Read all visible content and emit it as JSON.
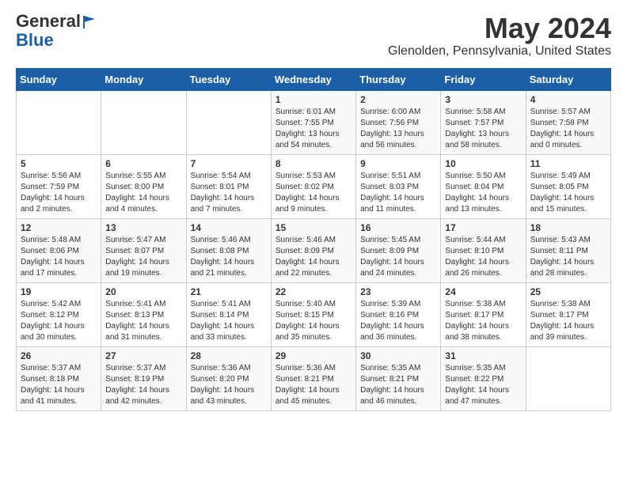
{
  "header": {
    "logo_general": "General",
    "logo_blue": "Blue",
    "month": "May 2024",
    "location": "Glenolden, Pennsylvania, United States"
  },
  "days_of_week": [
    "Sunday",
    "Monday",
    "Tuesday",
    "Wednesday",
    "Thursday",
    "Friday",
    "Saturday"
  ],
  "weeks": [
    [
      {
        "day": "",
        "sunrise": "",
        "sunset": "",
        "daylight": ""
      },
      {
        "day": "",
        "sunrise": "",
        "sunset": "",
        "daylight": ""
      },
      {
        "day": "",
        "sunrise": "",
        "sunset": "",
        "daylight": ""
      },
      {
        "day": "1",
        "sunrise": "Sunrise: 6:01 AM",
        "sunset": "Sunset: 7:55 PM",
        "daylight": "Daylight: 13 hours and 54 minutes."
      },
      {
        "day": "2",
        "sunrise": "Sunrise: 6:00 AM",
        "sunset": "Sunset: 7:56 PM",
        "daylight": "Daylight: 13 hours and 56 minutes."
      },
      {
        "day": "3",
        "sunrise": "Sunrise: 5:58 AM",
        "sunset": "Sunset: 7:57 PM",
        "daylight": "Daylight: 13 hours and 58 minutes."
      },
      {
        "day": "4",
        "sunrise": "Sunrise: 5:57 AM",
        "sunset": "Sunset: 7:58 PM",
        "daylight": "Daylight: 14 hours and 0 minutes."
      }
    ],
    [
      {
        "day": "5",
        "sunrise": "Sunrise: 5:56 AM",
        "sunset": "Sunset: 7:59 PM",
        "daylight": "Daylight: 14 hours and 2 minutes."
      },
      {
        "day": "6",
        "sunrise": "Sunrise: 5:55 AM",
        "sunset": "Sunset: 8:00 PM",
        "daylight": "Daylight: 14 hours and 4 minutes."
      },
      {
        "day": "7",
        "sunrise": "Sunrise: 5:54 AM",
        "sunset": "Sunset: 8:01 PM",
        "daylight": "Daylight: 14 hours and 7 minutes."
      },
      {
        "day": "8",
        "sunrise": "Sunrise: 5:53 AM",
        "sunset": "Sunset: 8:02 PM",
        "daylight": "Daylight: 14 hours and 9 minutes."
      },
      {
        "day": "9",
        "sunrise": "Sunrise: 5:51 AM",
        "sunset": "Sunset: 8:03 PM",
        "daylight": "Daylight: 14 hours and 11 minutes."
      },
      {
        "day": "10",
        "sunrise": "Sunrise: 5:50 AM",
        "sunset": "Sunset: 8:04 PM",
        "daylight": "Daylight: 14 hours and 13 minutes."
      },
      {
        "day": "11",
        "sunrise": "Sunrise: 5:49 AM",
        "sunset": "Sunset: 8:05 PM",
        "daylight": "Daylight: 14 hours and 15 minutes."
      }
    ],
    [
      {
        "day": "12",
        "sunrise": "Sunrise: 5:48 AM",
        "sunset": "Sunset: 8:06 PM",
        "daylight": "Daylight: 14 hours and 17 minutes."
      },
      {
        "day": "13",
        "sunrise": "Sunrise: 5:47 AM",
        "sunset": "Sunset: 8:07 PM",
        "daylight": "Daylight: 14 hours and 19 minutes."
      },
      {
        "day": "14",
        "sunrise": "Sunrise: 5:46 AM",
        "sunset": "Sunset: 8:08 PM",
        "daylight": "Daylight: 14 hours and 21 minutes."
      },
      {
        "day": "15",
        "sunrise": "Sunrise: 5:46 AM",
        "sunset": "Sunset: 8:09 PM",
        "daylight": "Daylight: 14 hours and 22 minutes."
      },
      {
        "day": "16",
        "sunrise": "Sunrise: 5:45 AM",
        "sunset": "Sunset: 8:09 PM",
        "daylight": "Daylight: 14 hours and 24 minutes."
      },
      {
        "day": "17",
        "sunrise": "Sunrise: 5:44 AM",
        "sunset": "Sunset: 8:10 PM",
        "daylight": "Daylight: 14 hours and 26 minutes."
      },
      {
        "day": "18",
        "sunrise": "Sunrise: 5:43 AM",
        "sunset": "Sunset: 8:11 PM",
        "daylight": "Daylight: 14 hours and 28 minutes."
      }
    ],
    [
      {
        "day": "19",
        "sunrise": "Sunrise: 5:42 AM",
        "sunset": "Sunset: 8:12 PM",
        "daylight": "Daylight: 14 hours and 30 minutes."
      },
      {
        "day": "20",
        "sunrise": "Sunrise: 5:41 AM",
        "sunset": "Sunset: 8:13 PM",
        "daylight": "Daylight: 14 hours and 31 minutes."
      },
      {
        "day": "21",
        "sunrise": "Sunrise: 5:41 AM",
        "sunset": "Sunset: 8:14 PM",
        "daylight": "Daylight: 14 hours and 33 minutes."
      },
      {
        "day": "22",
        "sunrise": "Sunrise: 5:40 AM",
        "sunset": "Sunset: 8:15 PM",
        "daylight": "Daylight: 14 hours and 35 minutes."
      },
      {
        "day": "23",
        "sunrise": "Sunrise: 5:39 AM",
        "sunset": "Sunset: 8:16 PM",
        "daylight": "Daylight: 14 hours and 36 minutes."
      },
      {
        "day": "24",
        "sunrise": "Sunrise: 5:38 AM",
        "sunset": "Sunset: 8:17 PM",
        "daylight": "Daylight: 14 hours and 38 minutes."
      },
      {
        "day": "25",
        "sunrise": "Sunrise: 5:38 AM",
        "sunset": "Sunset: 8:17 PM",
        "daylight": "Daylight: 14 hours and 39 minutes."
      }
    ],
    [
      {
        "day": "26",
        "sunrise": "Sunrise: 5:37 AM",
        "sunset": "Sunset: 8:18 PM",
        "daylight": "Daylight: 14 hours and 41 minutes."
      },
      {
        "day": "27",
        "sunrise": "Sunrise: 5:37 AM",
        "sunset": "Sunset: 8:19 PM",
        "daylight": "Daylight: 14 hours and 42 minutes."
      },
      {
        "day": "28",
        "sunrise": "Sunrise: 5:36 AM",
        "sunset": "Sunset: 8:20 PM",
        "daylight": "Daylight: 14 hours and 43 minutes."
      },
      {
        "day": "29",
        "sunrise": "Sunrise: 5:36 AM",
        "sunset": "Sunset: 8:21 PM",
        "daylight": "Daylight: 14 hours and 45 minutes."
      },
      {
        "day": "30",
        "sunrise": "Sunrise: 5:35 AM",
        "sunset": "Sunset: 8:21 PM",
        "daylight": "Daylight: 14 hours and 46 minutes."
      },
      {
        "day": "31",
        "sunrise": "Sunrise: 5:35 AM",
        "sunset": "Sunset: 8:22 PM",
        "daylight": "Daylight: 14 hours and 47 minutes."
      },
      {
        "day": "",
        "sunrise": "",
        "sunset": "",
        "daylight": ""
      }
    ]
  ]
}
